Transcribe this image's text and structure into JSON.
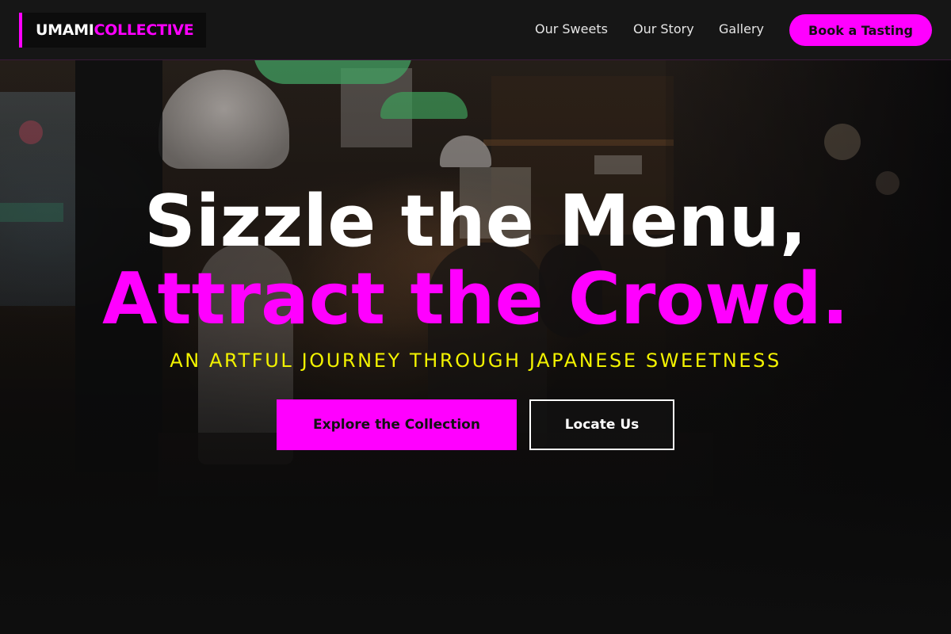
{
  "brand": {
    "part1": "UMAMI",
    "part2": "COLLECTIVE"
  },
  "nav": {
    "links": [
      "Our Sweets",
      "Our Story",
      "Gallery"
    ],
    "cta": "Book a Tasting"
  },
  "hero": {
    "headline_line1": "Sizzle the Menu,",
    "headline_line2": "Attract the Crowd.",
    "tagline": "AN ARTFUL JOURNEY THROUGH JAPANESE SWEETNESS",
    "primary_button": "Explore the Collection",
    "secondary_button": "Locate Us"
  },
  "colors": {
    "accent": "#ff00ff",
    "tagline": "#f2f200",
    "navbar_bg": "#161616"
  }
}
